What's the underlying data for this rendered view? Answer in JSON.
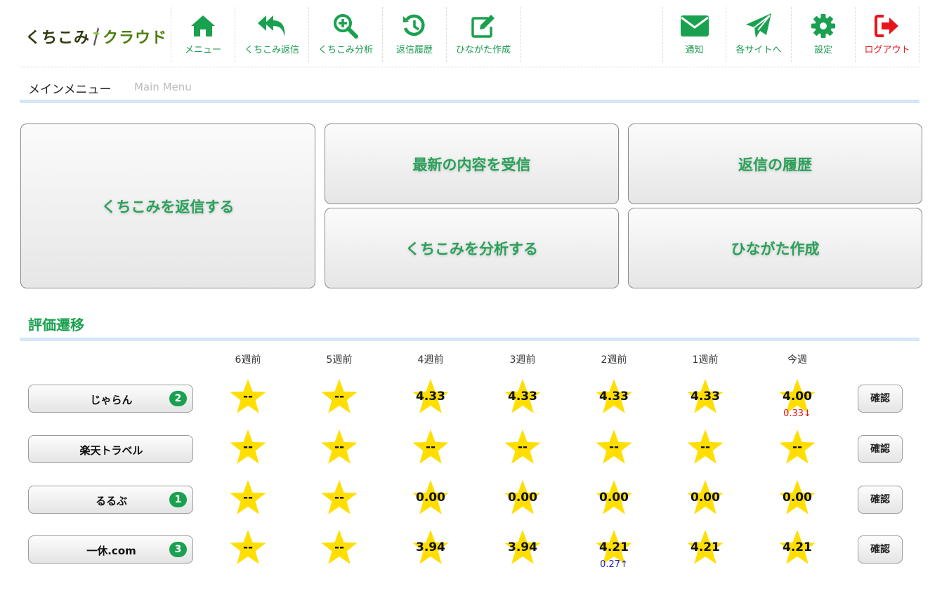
{
  "logo": {
    "part1": "くちこみ",
    "part2": "クラウド"
  },
  "nav_left": [
    {
      "label": "メニュー",
      "icon": "home-icon"
    },
    {
      "label": "くちこみ返信",
      "icon": "reply-all-icon"
    },
    {
      "label": "くちこみ分析",
      "icon": "zoom-in-icon"
    },
    {
      "label": "返信履歴",
      "icon": "history-icon"
    },
    {
      "label": "ひながた作成",
      "icon": "edit-icon"
    }
  ],
  "nav_right": [
    {
      "label": "通知",
      "icon": "mail-icon"
    },
    {
      "label": "各サイトへ",
      "icon": "send-icon"
    },
    {
      "label": "設定",
      "icon": "gear-icon"
    },
    {
      "label": "ログアウト",
      "icon": "logout-icon"
    }
  ],
  "colors": {
    "accent": "#1aa14f",
    "logout": "#e8141c",
    "star": "#ffde00",
    "divider": "#d6e6f7"
  },
  "main_menu": {
    "title": "メインメニュー",
    "subtitle": "Main Menu"
  },
  "big_buttons": {
    "reply": "くちこみを返信する",
    "receive": "最新の内容を受信",
    "history": "返信の履歴",
    "analyze": "くちこみを分析する",
    "template": "ひながた作成"
  },
  "rating": {
    "title": "評価遷移",
    "weeks": [
      "6週前",
      "5週前",
      "4週前",
      "3週前",
      "2週前",
      "1週前",
      "今週"
    ],
    "confirm_label": "確認",
    "rows": [
      {
        "site": "じゃらん",
        "badge": "2",
        "values": [
          "--",
          "--",
          "4.33",
          "4.33",
          "4.33",
          "4.33",
          "4.00"
        ],
        "delta": {
          "week_index": 6,
          "text": "0.33↓",
          "dir": "down"
        }
      },
      {
        "site": "楽天トラベル",
        "badge": "",
        "values": [
          "--",
          "--",
          "--",
          "--",
          "--",
          "--",
          "--"
        ],
        "delta": null
      },
      {
        "site": "るるぶ",
        "badge": "1",
        "values": [
          "--",
          "--",
          "0.00",
          "0.00",
          "0.00",
          "0.00",
          "0.00"
        ],
        "delta": null
      },
      {
        "site": "一休.com",
        "badge": "3",
        "values": [
          "--",
          "--",
          "3.94",
          "3.94",
          "4.21",
          "4.21",
          "4.21"
        ],
        "delta": {
          "week_index": 4,
          "text": "0.27↑",
          "dir": "up"
        }
      }
    ]
  }
}
